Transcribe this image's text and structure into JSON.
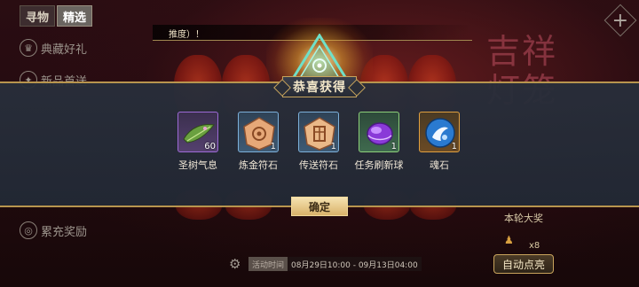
{
  "tabs": [
    "寻物",
    "精选"
  ],
  "sidebar": {
    "items": [
      {
        "label": "典藏好礼",
        "icon": "crown-icon"
      },
      {
        "label": "新品首送",
        "icon": "gift-icon"
      },
      {
        "label": "累充奖励",
        "icon": "coin-icon"
      }
    ]
  },
  "banner_text": "推度）！",
  "decoration_title": "吉祥灯笼",
  "reward_dialog": {
    "title": "恭喜获得",
    "items": [
      {
        "name": "圣树气息",
        "count": "60",
        "quality": "purple",
        "icon": "leaf-icon"
      },
      {
        "name": "炼金符石",
        "count": "1",
        "quality": "blue",
        "icon": "rune-stone-icon"
      },
      {
        "name": "传送符石",
        "count": "1",
        "quality": "blue",
        "icon": "teleport-stone-icon"
      },
      {
        "name": "任务刷新球",
        "count": "1",
        "quality": "green",
        "icon": "orb-icon"
      },
      {
        "name": "魂石",
        "count": "1",
        "quality": "orange",
        "icon": "soul-stone-icon"
      }
    ],
    "confirm_label": "确定"
  },
  "right_panel": {
    "prize_label": "本轮大奖",
    "count": "x8",
    "auto_button_label": "自动点亮"
  },
  "event": {
    "label": "活动时间",
    "time": "08月29日10:00 - 09月13日04:00"
  }
}
